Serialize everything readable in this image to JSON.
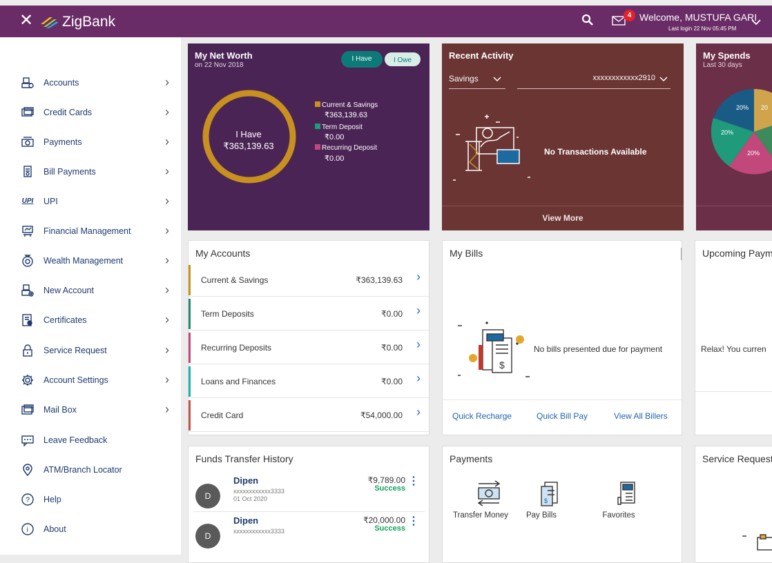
{
  "header": {
    "brand": "ZigBank",
    "mail_count": "4",
    "welcome": "Welcome, MUSTUFA GARI",
    "last_login": "Last login 22 Nov 05:45 PM"
  },
  "sidebar": {
    "items": [
      {
        "label": "Accounts",
        "icon": "accounts-icon"
      },
      {
        "label": "Credit Cards",
        "icon": "credit-card-icon"
      },
      {
        "label": "Payments",
        "icon": "payments-icon"
      },
      {
        "label": "Bill Payments",
        "icon": "bill-payments-icon"
      },
      {
        "label": "UPI",
        "icon": "upi-icon"
      },
      {
        "label": "Financial Management",
        "icon": "financial-management-icon"
      },
      {
        "label": "Wealth Management",
        "icon": "wealth-management-icon"
      },
      {
        "label": "New Account",
        "icon": "new-account-icon"
      },
      {
        "label": "Certificates",
        "icon": "certificates-icon"
      },
      {
        "label": "Service Request",
        "icon": "lock-icon"
      },
      {
        "label": "Account Settings",
        "icon": "gear-icon"
      },
      {
        "label": "Mail Box",
        "icon": "mailbox-icon"
      },
      {
        "label": "Leave Feedback",
        "icon": "feedback-icon"
      },
      {
        "label": "ATM/Branch Locator",
        "icon": "location-pin-icon"
      },
      {
        "label": "Help",
        "icon": "help-icon"
      },
      {
        "label": "About",
        "icon": "info-icon"
      }
    ],
    "upi_glyph": "UPI"
  },
  "networth": {
    "title": "My Net Worth",
    "date": "on 22 Nov 2018",
    "toggle_have": "I Have",
    "toggle_owe": "I Owe",
    "ring_label": "I Have",
    "ring_value": "₹363,139.63",
    "legend": [
      {
        "name": "Current & Savings",
        "value": "₹363,139.63",
        "color": "#c8901e"
      },
      {
        "name": "Term Deposit",
        "value": "₹0.00",
        "color": "#1f9a7a"
      },
      {
        "name": "Recurring Deposit",
        "value": "₹0.00",
        "color": "#c2477a"
      }
    ]
  },
  "recent": {
    "title": "Recent Activity",
    "account_type": "Savings",
    "account_number": "xxxxxxxxxxxx2910",
    "empty": "No Transactions Available",
    "view_more": "View More"
  },
  "spends": {
    "title": "My Spends",
    "period": "Last 30 days",
    "slice_labels": [
      "20%",
      "20",
      "20%",
      "20%"
    ]
  },
  "accounts": {
    "title": "My Accounts",
    "rows": [
      {
        "name": "Current & Savings",
        "amount": "₹363,139.63",
        "color": "#c8901e"
      },
      {
        "name": "Term Deposits",
        "amount": "₹0.00",
        "color": "#1f8a6a"
      },
      {
        "name": "Recurring Deposits",
        "amount": "₹0.00",
        "color": "#c2477a"
      },
      {
        "name": "Loans and Finances",
        "amount": "₹0.00",
        "color": "#16b3b0"
      },
      {
        "name": "Credit Card",
        "amount": "₹54,000.00",
        "color": "#c9504a"
      }
    ]
  },
  "bills": {
    "title": "My Bills",
    "empty": "No bills presented due for payment",
    "links": [
      "Quick Recharge",
      "Quick Bill Pay",
      "View All Billers"
    ]
  },
  "upcoming": {
    "title": "Upcoming Payme",
    "empty": "Relax! You curren"
  },
  "funds": {
    "title": "Funds Transfer History",
    "rows": [
      {
        "initial": "D",
        "name": "Dipen",
        "account": "xxxxxxxxxxxx3333",
        "date": "01 Oct 2020",
        "amount": "₹9,789.00",
        "status": "Success"
      },
      {
        "initial": "D",
        "name": "Dipen",
        "account": "xxxxxxxxxxxx3333",
        "date": "",
        "amount": "₹20,000.00",
        "status": "Success"
      }
    ]
  },
  "payments": {
    "title": "Payments",
    "items": [
      "Transfer Money",
      "Pay Bills",
      "Favorites"
    ]
  },
  "service": {
    "title": "Service Request"
  }
}
